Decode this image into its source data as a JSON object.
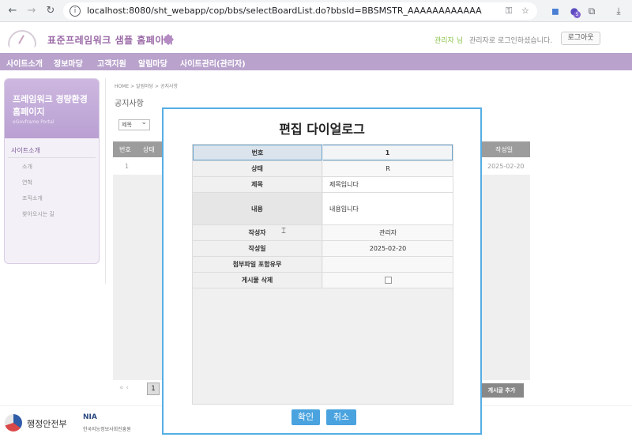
{
  "browser": {
    "url": "localhost:8080/sht_webapp/cop/bbs/selectBoardList.do?bbsId=BBSMSTR_AAAAAAAAAAAA",
    "ext_badge": "5"
  },
  "header": {
    "site_title": "표준프레임워크 샘플 홈페이지",
    "user_name": "관리자 님",
    "login_msg": "관리자로 로그인하셨습니다.",
    "logout_label": "로그아웃"
  },
  "menu": [
    "사이트소개",
    "정보마당",
    "고객지원",
    "알림마당",
    "사이트관리(관리자)"
  ],
  "sidebar": {
    "title": "프레임워크 경량환경 홈페이지",
    "subtitle": "eGovframe Portal",
    "section": "사이트소개",
    "items": [
      "소개",
      "연혁",
      "조직소개",
      "찾아오시는 길"
    ]
  },
  "main": {
    "breadcrumb": "HOME > 알림마당 > 공지사항",
    "page_title": "공지사항",
    "search_option": "제목",
    "columns": {
      "no": "번호",
      "status": "상태",
      "date": "작성일"
    },
    "row": {
      "no": "1",
      "date": "2025-02-20"
    },
    "pager_prev": "«  ‹",
    "current_page": "1",
    "add_button": "게시글 추가"
  },
  "footer": {
    "mois": "행정안전부",
    "nia": "NIA",
    "nia_sub": "한국지능정보사회진흥원"
  },
  "modal": {
    "title": "편집 다이얼로그",
    "fields": [
      {
        "label": "번호",
        "value": "1"
      },
      {
        "label": "상태",
        "value": "R"
      },
      {
        "label": "제목",
        "value": "제목입니다"
      },
      {
        "label": "내용",
        "value": "내용입니다"
      },
      {
        "label": "작성자",
        "value": "관리자"
      },
      {
        "label": "작성일",
        "value": "2025-02-20"
      },
      {
        "label": "첨부파일 포함유무",
        "value": ""
      },
      {
        "label": "게시물 삭제",
        "value": ""
      }
    ],
    "confirm_label": "확인",
    "cancel_label": "취소"
  }
}
